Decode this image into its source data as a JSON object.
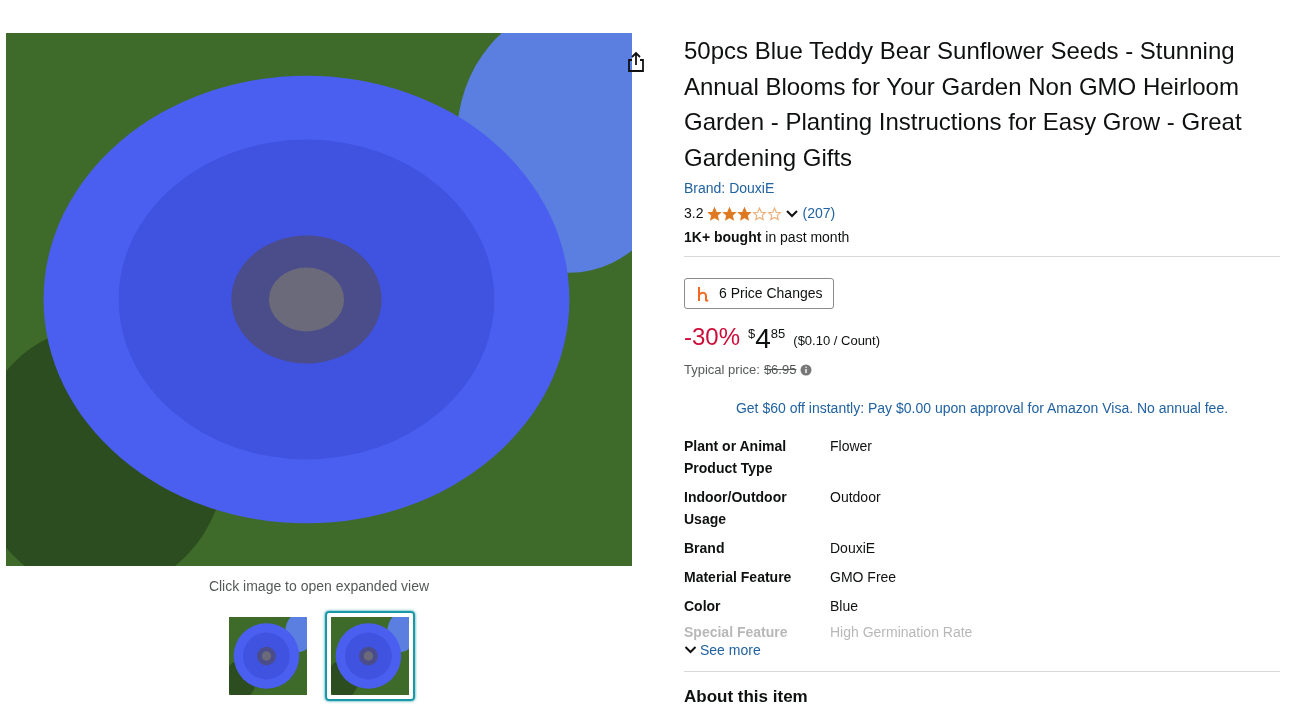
{
  "gallery": {
    "caption": "Click image to open expanded view",
    "thumbnails": [
      {
        "selected": false
      },
      {
        "selected": true
      }
    ]
  },
  "product": {
    "title": "50pcs Blue Teddy Bear Sunflower Seeds - Stunning Annual Blooms for Your Garden Non GMO Heirloom Garden - Planting Instructions for Easy Grow - Great Gardening Gifts",
    "brand_link": "Brand: DouxiE",
    "rating": "3.2",
    "stars": 3,
    "review_count": "(207)",
    "bought": "**1K+ bought** in past month",
    "price_changes_button": "6 Price Changes",
    "discount": "-30%",
    "currency": "$",
    "price_whole": "4",
    "price_fraction": "85",
    "unit_price": "($0.10 / Count)",
    "typical_price_label": "Typical price:",
    "typical_price": "$6.95",
    "promo": "Get $60 off instantly: Pay $0.00 upon approval for Amazon Visa. No annual fee.",
    "specs": [
      {
        "label": "Plant or Animal Product Type",
        "value": "Flower",
        "faded": false
      },
      {
        "label": "Indoor/Outdoor Usage",
        "value": "Outdoor",
        "faded": false
      },
      {
        "label": "Brand",
        "value": "DouxiE",
        "faded": false
      },
      {
        "label": "Material Feature",
        "value": "GMO Free",
        "faded": false
      },
      {
        "label": "Color",
        "value": "Blue",
        "faded": false
      },
      {
        "label": "Special Feature",
        "value": "High Germination Rate",
        "faded": true
      }
    ],
    "see_more": "See more",
    "about_heading": "About this item"
  }
}
